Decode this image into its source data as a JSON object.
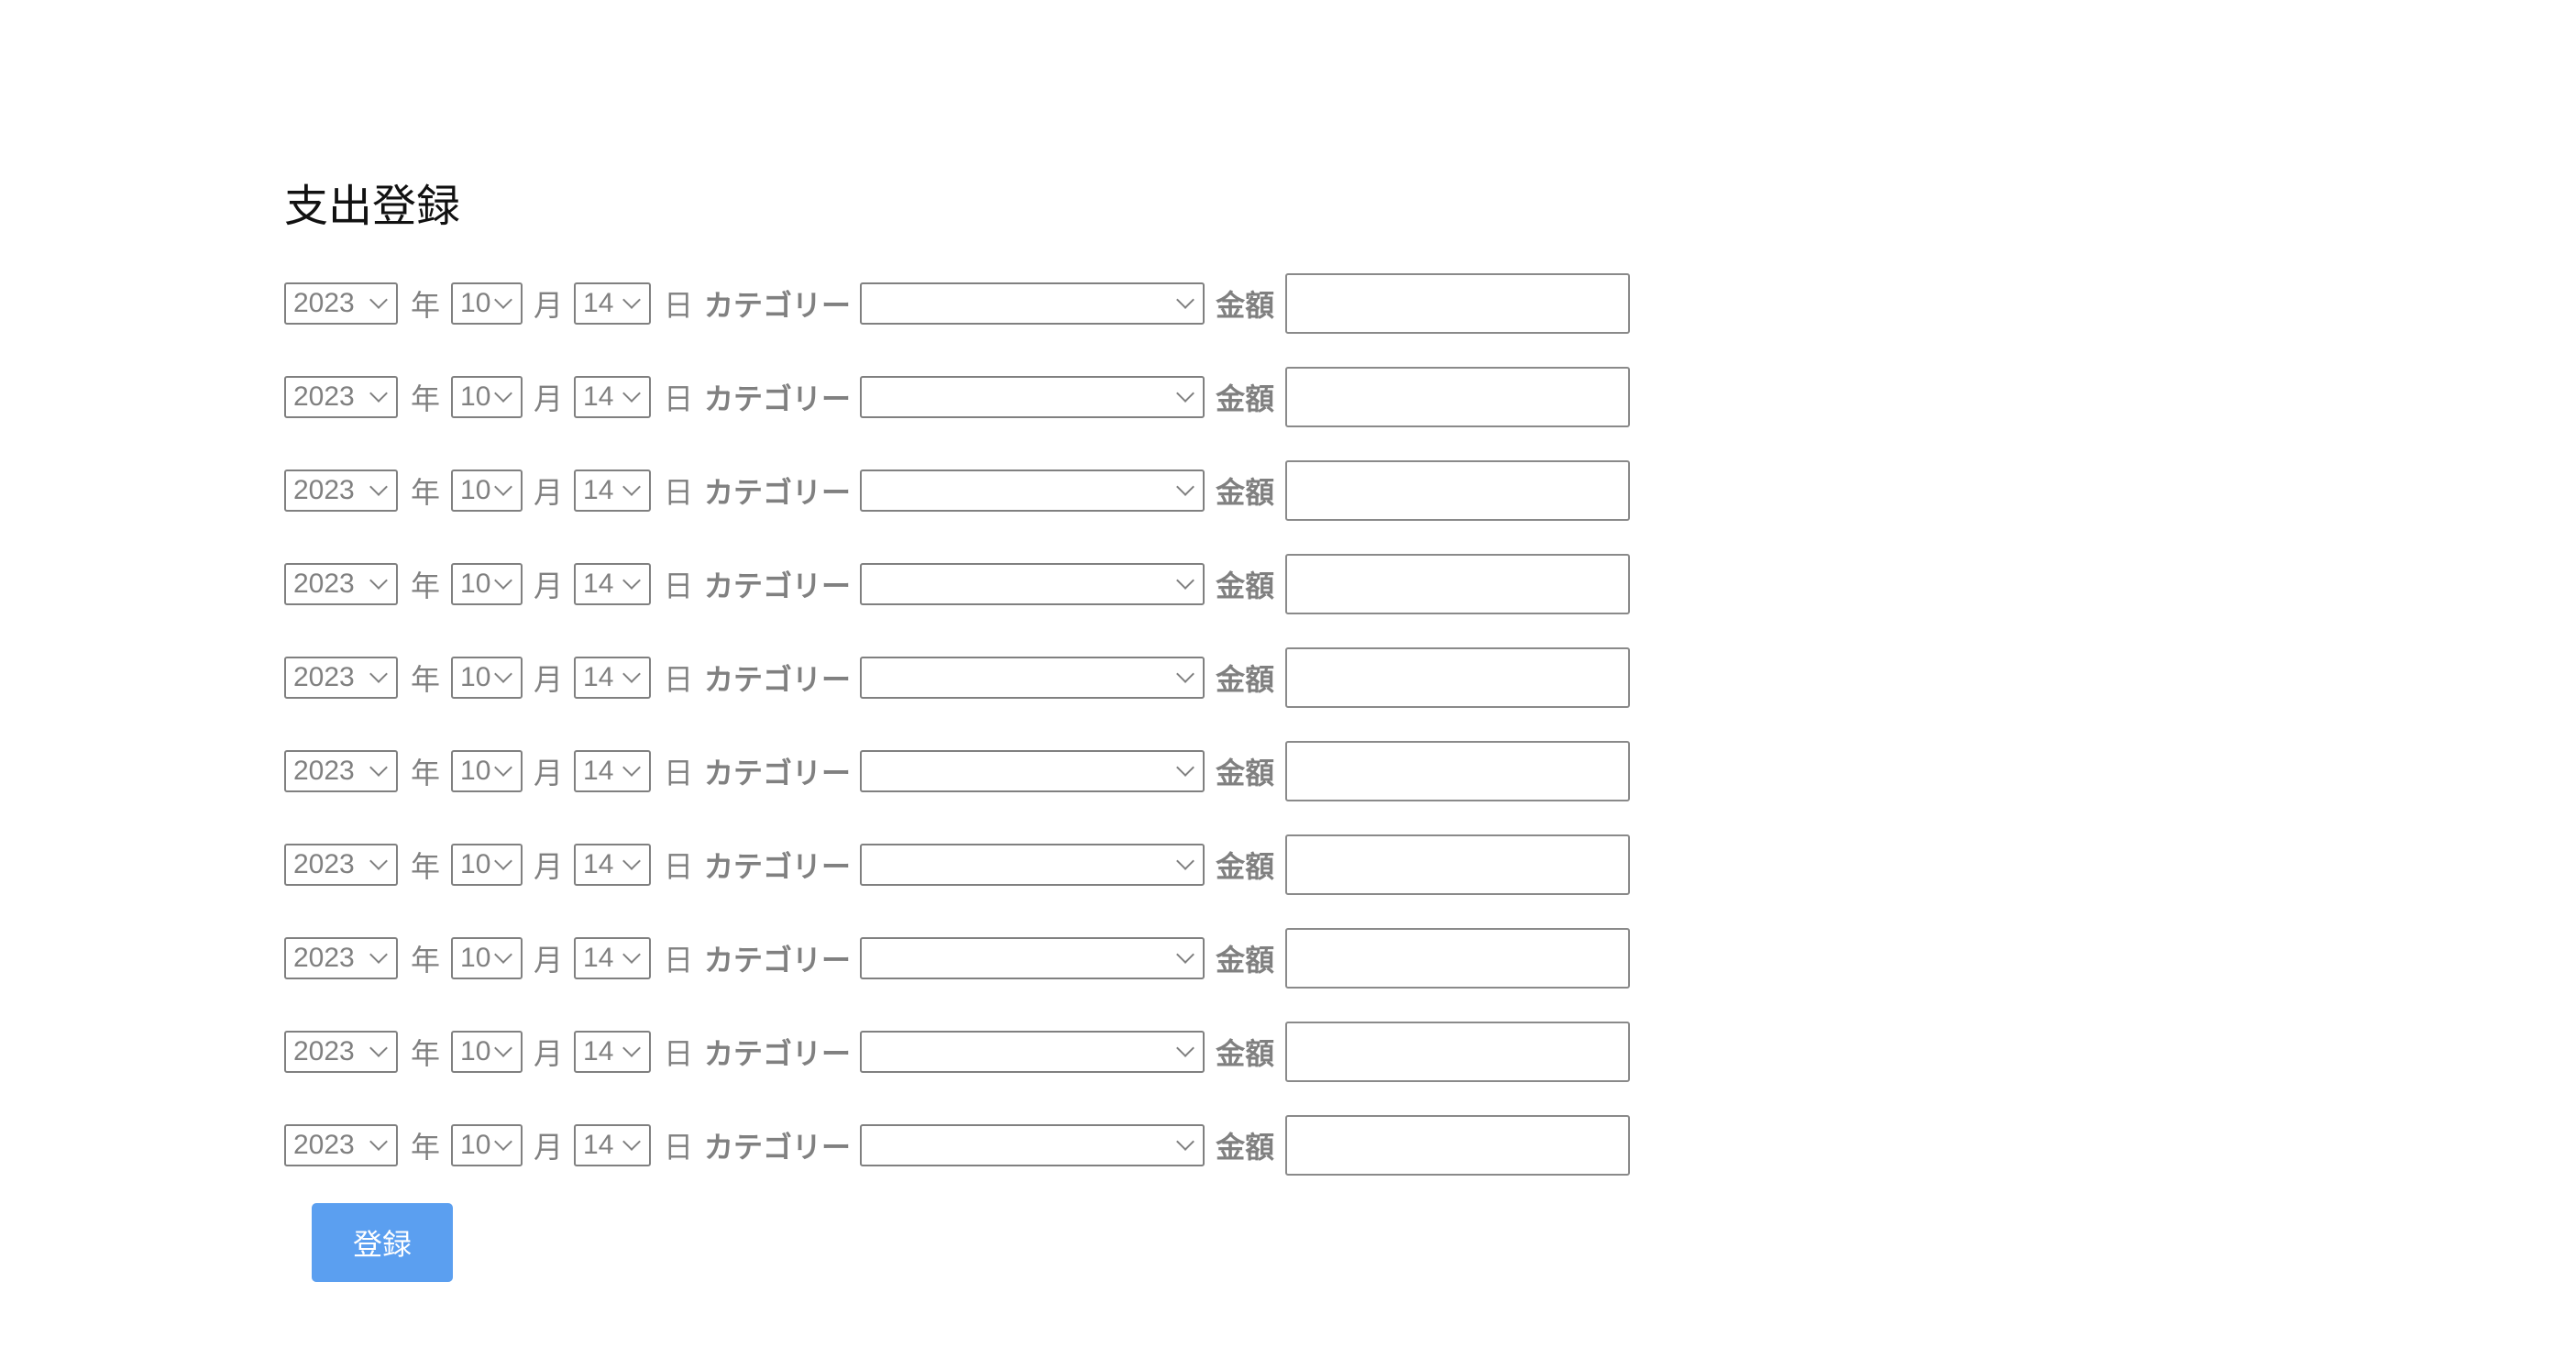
{
  "form": {
    "title": "支出登録",
    "labels": {
      "year": "年",
      "month": "月",
      "day": "日",
      "category": "カテゴリー",
      "amount": "金額"
    },
    "rows": [
      {
        "year": "2023",
        "month": "10",
        "day": "14",
        "category": "",
        "amount": ""
      },
      {
        "year": "2023",
        "month": "10",
        "day": "14",
        "category": "",
        "amount": ""
      },
      {
        "year": "2023",
        "month": "10",
        "day": "14",
        "category": "",
        "amount": ""
      },
      {
        "year": "2023",
        "month": "10",
        "day": "14",
        "category": "",
        "amount": ""
      },
      {
        "year": "2023",
        "month": "10",
        "day": "14",
        "category": "",
        "amount": ""
      },
      {
        "year": "2023",
        "month": "10",
        "day": "14",
        "category": "",
        "amount": ""
      },
      {
        "year": "2023",
        "month": "10",
        "day": "14",
        "category": "",
        "amount": ""
      },
      {
        "year": "2023",
        "month": "10",
        "day": "14",
        "category": "",
        "amount": ""
      },
      {
        "year": "2023",
        "month": "10",
        "day": "14",
        "category": "",
        "amount": ""
      },
      {
        "year": "2023",
        "month": "10",
        "day": "14",
        "category": "",
        "amount": ""
      }
    ],
    "submit_label": "登録",
    "colors": {
      "button": "#5b9ff0",
      "label": "#808080",
      "title": "#111111"
    }
  }
}
